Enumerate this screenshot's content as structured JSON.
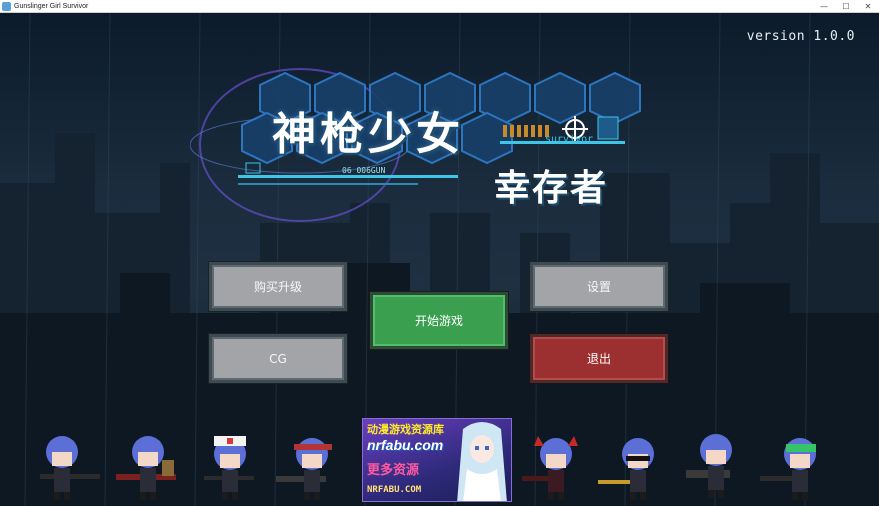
{
  "window": {
    "title": "Gunslinger Girl Survivor",
    "minimize": "—",
    "maximize": "☐",
    "close": "✕"
  },
  "version": "version 1.0.0",
  "logo": {
    "title": "神枪少女",
    "subtitle": "幸存者",
    "survivor": "survivor",
    "code": "06 006GUN"
  },
  "menu": {
    "buy_upgrade": "购买升级",
    "cg": "CG",
    "start": "开始游戏",
    "settings": "设置",
    "exit": "退出"
  },
  "ad": {
    "line1": "动漫游戏资源库",
    "line2": "nrfabu.com",
    "line3": "更多资源",
    "line4": "NRFABU.COM"
  },
  "colors": {
    "button_gray": "#a3a4a7",
    "button_green": "#3aa050",
    "button_red": "#9c2f30",
    "logo_accent": "#3cc6e8"
  }
}
